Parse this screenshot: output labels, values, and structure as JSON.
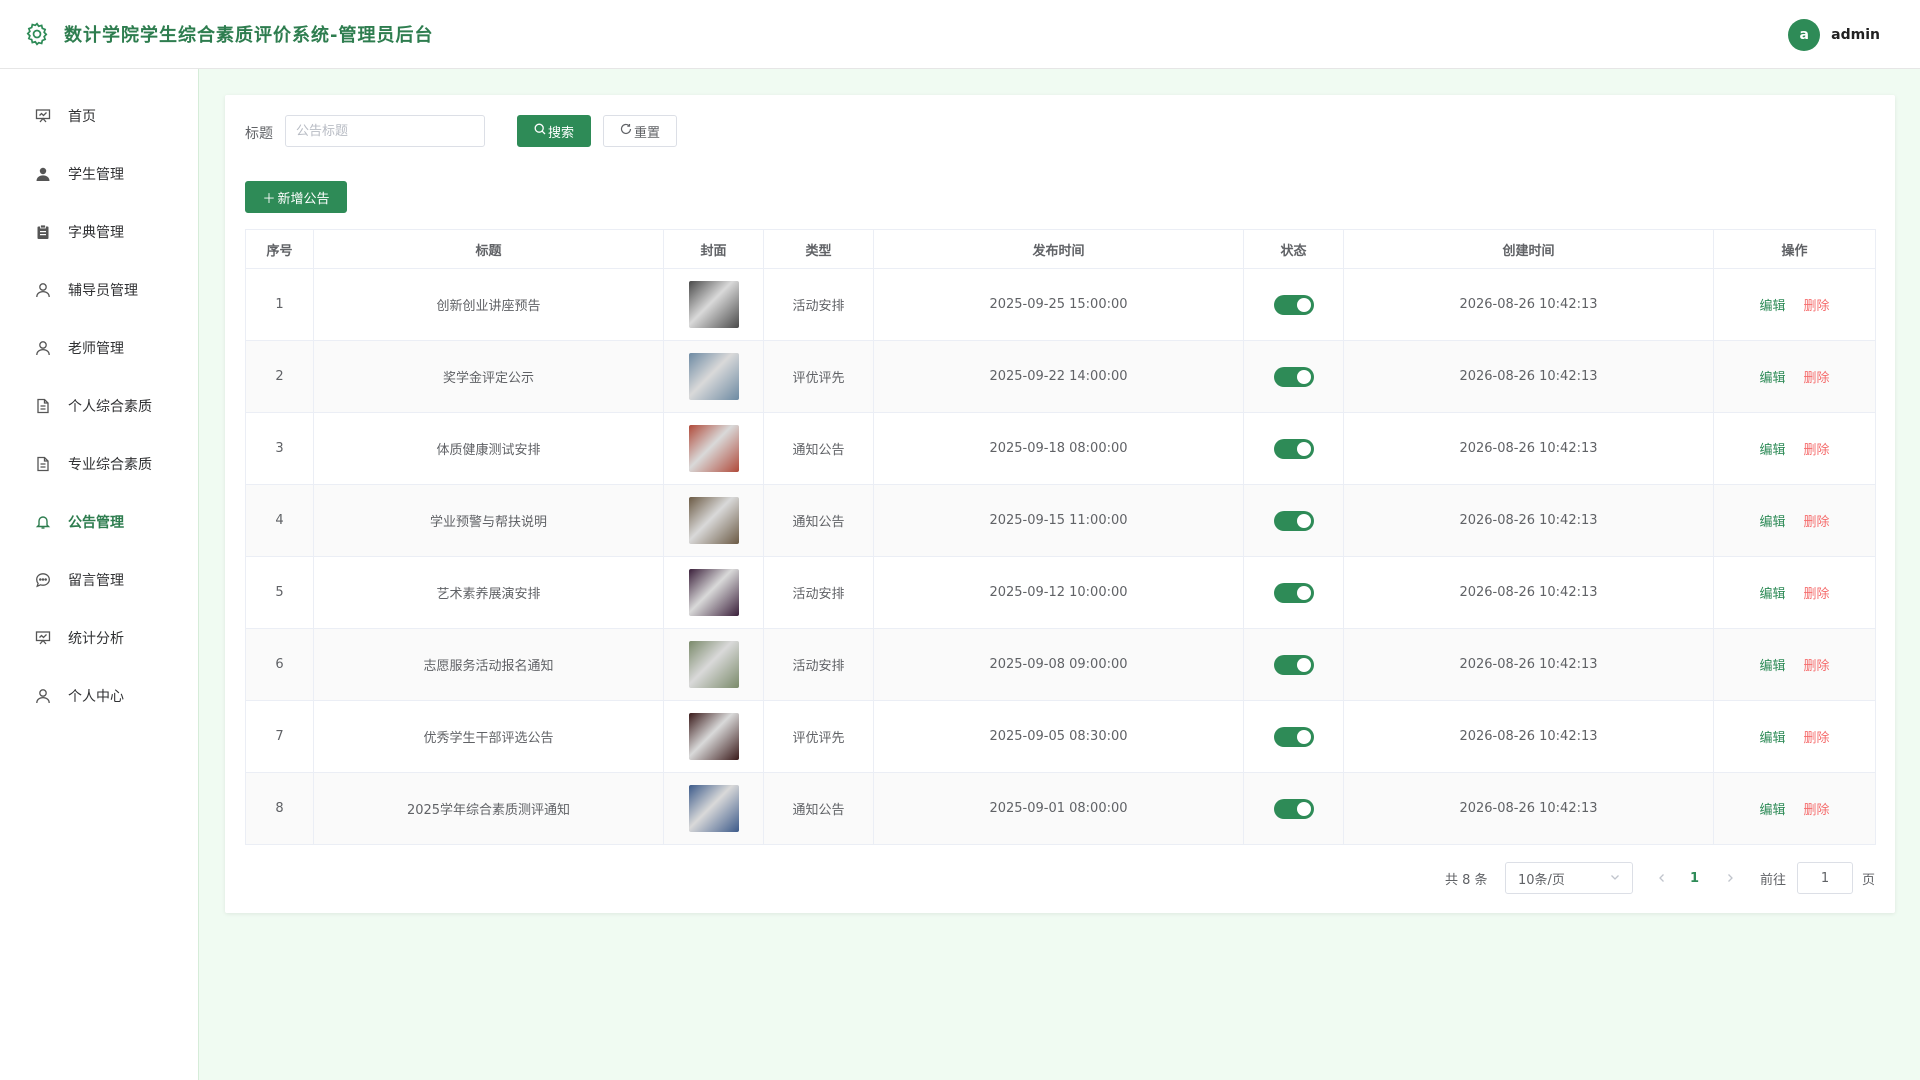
{
  "header": {
    "title": "数计学院学生综合素质评价系统-管理员后台",
    "avatar_letter": "a",
    "username": "admin",
    "accent_color": "#2e8b57"
  },
  "sidebar": {
    "items": [
      {
        "label": "首页",
        "icon": "presentation-icon",
        "active": false
      },
      {
        "label": "学生管理",
        "icon": "user-filled-icon",
        "active": false
      },
      {
        "label": "字典管理",
        "icon": "clipboard-icon",
        "active": false
      },
      {
        "label": "辅导员管理",
        "icon": "user-icon",
        "active": false
      },
      {
        "label": "老师管理",
        "icon": "user-icon",
        "active": false
      },
      {
        "label": "个人综合素质",
        "icon": "document-icon",
        "active": false
      },
      {
        "label": "专业综合素质",
        "icon": "document-icon",
        "active": false
      },
      {
        "label": "公告管理",
        "icon": "bell-icon",
        "active": true
      },
      {
        "label": "留言管理",
        "icon": "chat-icon",
        "active": false
      },
      {
        "label": "统计分析",
        "icon": "presentation-icon",
        "active": false
      },
      {
        "label": "个人中心",
        "icon": "user-icon",
        "active": false
      }
    ]
  },
  "search": {
    "label": "标题",
    "placeholder": "公告标题",
    "value": "",
    "search_button": "搜索",
    "reset_button": "重置"
  },
  "toolbar": {
    "add_button": "新增公告"
  },
  "table": {
    "columns": [
      "序号",
      "标题",
      "封面",
      "类型",
      "发布时间",
      "状态",
      "创建时间",
      "操作"
    ],
    "edit_label": "编辑",
    "delete_label": "删除",
    "rows": [
      {
        "index": "1",
        "title": "创新创业讲座预告",
        "type": "活动安排",
        "publish_time": "2025-09-25 15:00:00",
        "status": true,
        "created": "2026-08-26 10:42:13",
        "cover_color": "#4a4a4a"
      },
      {
        "index": "2",
        "title": "奖学金评定公示",
        "type": "评优评先",
        "publish_time": "2025-09-22 14:00:00",
        "status": true,
        "created": "2026-08-26 10:42:13",
        "cover_color": "#6d8aa3"
      },
      {
        "index": "3",
        "title": "体质健康测试安排",
        "type": "通知公告",
        "publish_time": "2025-09-18 08:00:00",
        "status": true,
        "created": "2026-08-26 10:42:13",
        "cover_color": "#b04a3a"
      },
      {
        "index": "4",
        "title": "学业预警与帮扶说明",
        "type": "通知公告",
        "publish_time": "2025-09-15 11:00:00",
        "status": true,
        "created": "2026-08-26 10:42:13",
        "cover_color": "#6b5a44"
      },
      {
        "index": "5",
        "title": "艺术素养展演安排",
        "type": "活动安排",
        "publish_time": "2025-09-12 10:00:00",
        "status": true,
        "created": "2026-08-26 10:42:13",
        "cover_color": "#3a1f3a"
      },
      {
        "index": "6",
        "title": "志愿服务活动报名通知",
        "type": "活动安排",
        "publish_time": "2025-09-08 09:00:00",
        "status": true,
        "created": "2026-08-26 10:42:13",
        "cover_color": "#7a8a6a"
      },
      {
        "index": "7",
        "title": "优秀学生干部评选公告",
        "type": "评优评先",
        "publish_time": "2025-09-05 08:30:00",
        "status": true,
        "created": "2026-08-26 10:42:13",
        "cover_color": "#3a1a1a"
      },
      {
        "index": "8",
        "title": "2025学年综合素质测评通知",
        "type": "通知公告",
        "publish_time": "2025-09-01 08:00:00",
        "status": true,
        "created": "2026-08-26 10:42:13",
        "cover_color": "#3c5a8a"
      }
    ]
  },
  "pagination": {
    "total_text": "共 8 条",
    "page_size": "10条/页",
    "current_page": "1",
    "goto_label": "前往",
    "goto_value": "1",
    "goto_suffix": "页"
  }
}
